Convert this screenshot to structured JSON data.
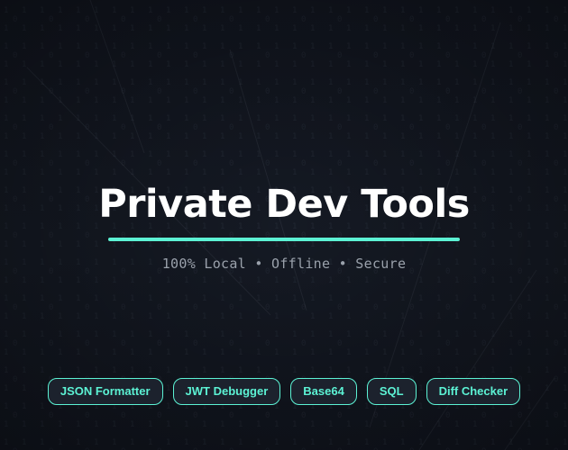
{
  "hero": {
    "title": "Private Dev Tools",
    "subtitle": "100% Local • Offline • Secure"
  },
  "tools": [
    {
      "label": "JSON Formatter"
    },
    {
      "label": "JWT Debugger"
    },
    {
      "label": "Base64"
    },
    {
      "label": "SQL"
    },
    {
      "label": "Diff Checker"
    }
  ],
  "colors": {
    "background": "#141923",
    "accent": "#5cf2d4",
    "title": "#ffffff",
    "subtitle": "#9aa1ab"
  }
}
